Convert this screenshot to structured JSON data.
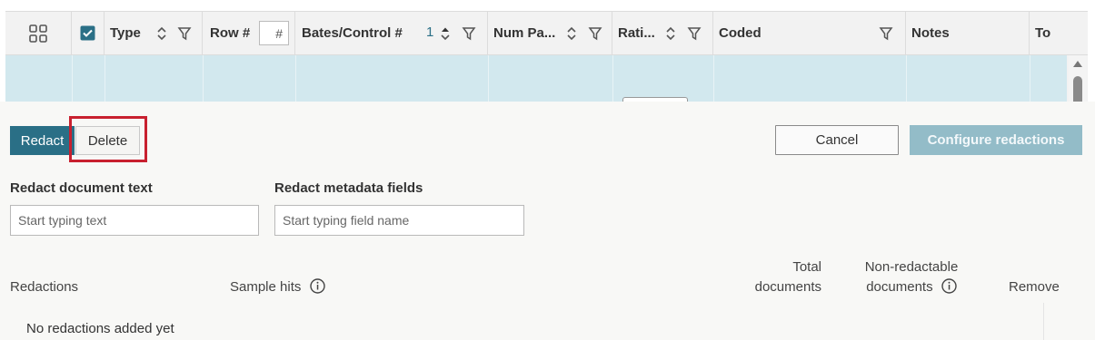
{
  "grid": {
    "columns": [
      {
        "label": "",
        "icon": "column-chooser-icon"
      },
      {
        "label": "",
        "icon": "select-all-checkbox",
        "checked": true
      },
      {
        "label": "Type",
        "sortable": true,
        "filterable": true
      },
      {
        "label": "Row #",
        "input_placeholder": "#"
      },
      {
        "label": "Bates/Control #",
        "sort_index": "1",
        "sortable": true,
        "filterable": true
      },
      {
        "label": "Num Pa...",
        "sortable": true,
        "filterable": true
      },
      {
        "label": "Rati...",
        "sortable": true,
        "filterable": true
      },
      {
        "label": "Coded",
        "filterable": true
      },
      {
        "label": "Notes"
      },
      {
        "label": "To"
      }
    ]
  },
  "toolbar": {
    "redact_label": "Redact",
    "delete_label": "Delete",
    "cancel_label": "Cancel",
    "configure_label": "Configure redactions"
  },
  "redact_text": {
    "label": "Redact document text",
    "placeholder": "Start typing text"
  },
  "redact_metadata": {
    "label": "Redact metadata fields",
    "placeholder": "Start typing field name"
  },
  "redactions_table": {
    "headers": {
      "redactions": "Redactions",
      "sample_hits": "Sample hits",
      "total_documents_line1": "Total",
      "total_documents_line2": "documents",
      "non_redactable_line1": "Non-redactable",
      "non_redactable_line2": "documents",
      "remove": "Remove"
    },
    "empty_message": "No redactions added yet"
  },
  "colors": {
    "primary": "#2a6f86",
    "primary_disabled": "#93bcc8",
    "selected_row": "#d2e8ee",
    "highlight": "#c8202f",
    "sort_index": "#2a6f86"
  }
}
